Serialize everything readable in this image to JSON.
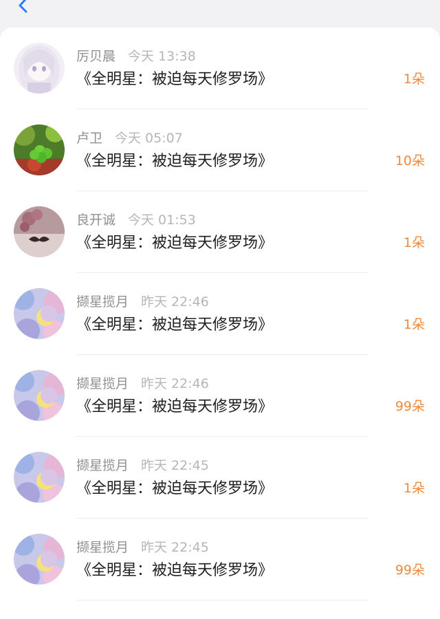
{
  "rows": [
    {
      "name": "厉贝晨",
      "time": "今天 13:38",
      "title": "《全明星：被迫每天修罗场》",
      "amount": "1朵",
      "avatar": "anime-girl-avatar"
    },
    {
      "name": "卢卫",
      "time": "今天 05:07",
      "title": "《全明星：被迫每天修罗场》",
      "amount": "10朵",
      "avatar": "clover-avatar"
    },
    {
      "name": "良开诚",
      "time": "今天 01:53",
      "title": "《全明星：被迫每天修罗场》",
      "amount": "1朵",
      "avatar": "mustache-avatar"
    },
    {
      "name": "撷星揽月",
      "time": "昨天 22:46",
      "title": "《全明星：被迫每天修罗场》",
      "amount": "1朵",
      "avatar": "moon-avatar"
    },
    {
      "name": "撷星揽月",
      "time": "昨天 22:46",
      "title": "《全明星：被迫每天修罗场》",
      "amount": "99朵",
      "avatar": "moon-avatar"
    },
    {
      "name": "撷星揽月",
      "time": "昨天 22:45",
      "title": "《全明星：被迫每天修罗场》",
      "amount": "1朵",
      "avatar": "moon-avatar"
    },
    {
      "name": "撷星揽月",
      "time": "昨天 22:45",
      "title": "《全明星：被迫每天修罗场》",
      "amount": "99朵",
      "avatar": "moon-avatar"
    }
  ],
  "colors": {
    "accent": "#2f7cf6",
    "amount": "#ee8a3e"
  },
  "icons": {
    "back": "back-chevron-icon"
  }
}
